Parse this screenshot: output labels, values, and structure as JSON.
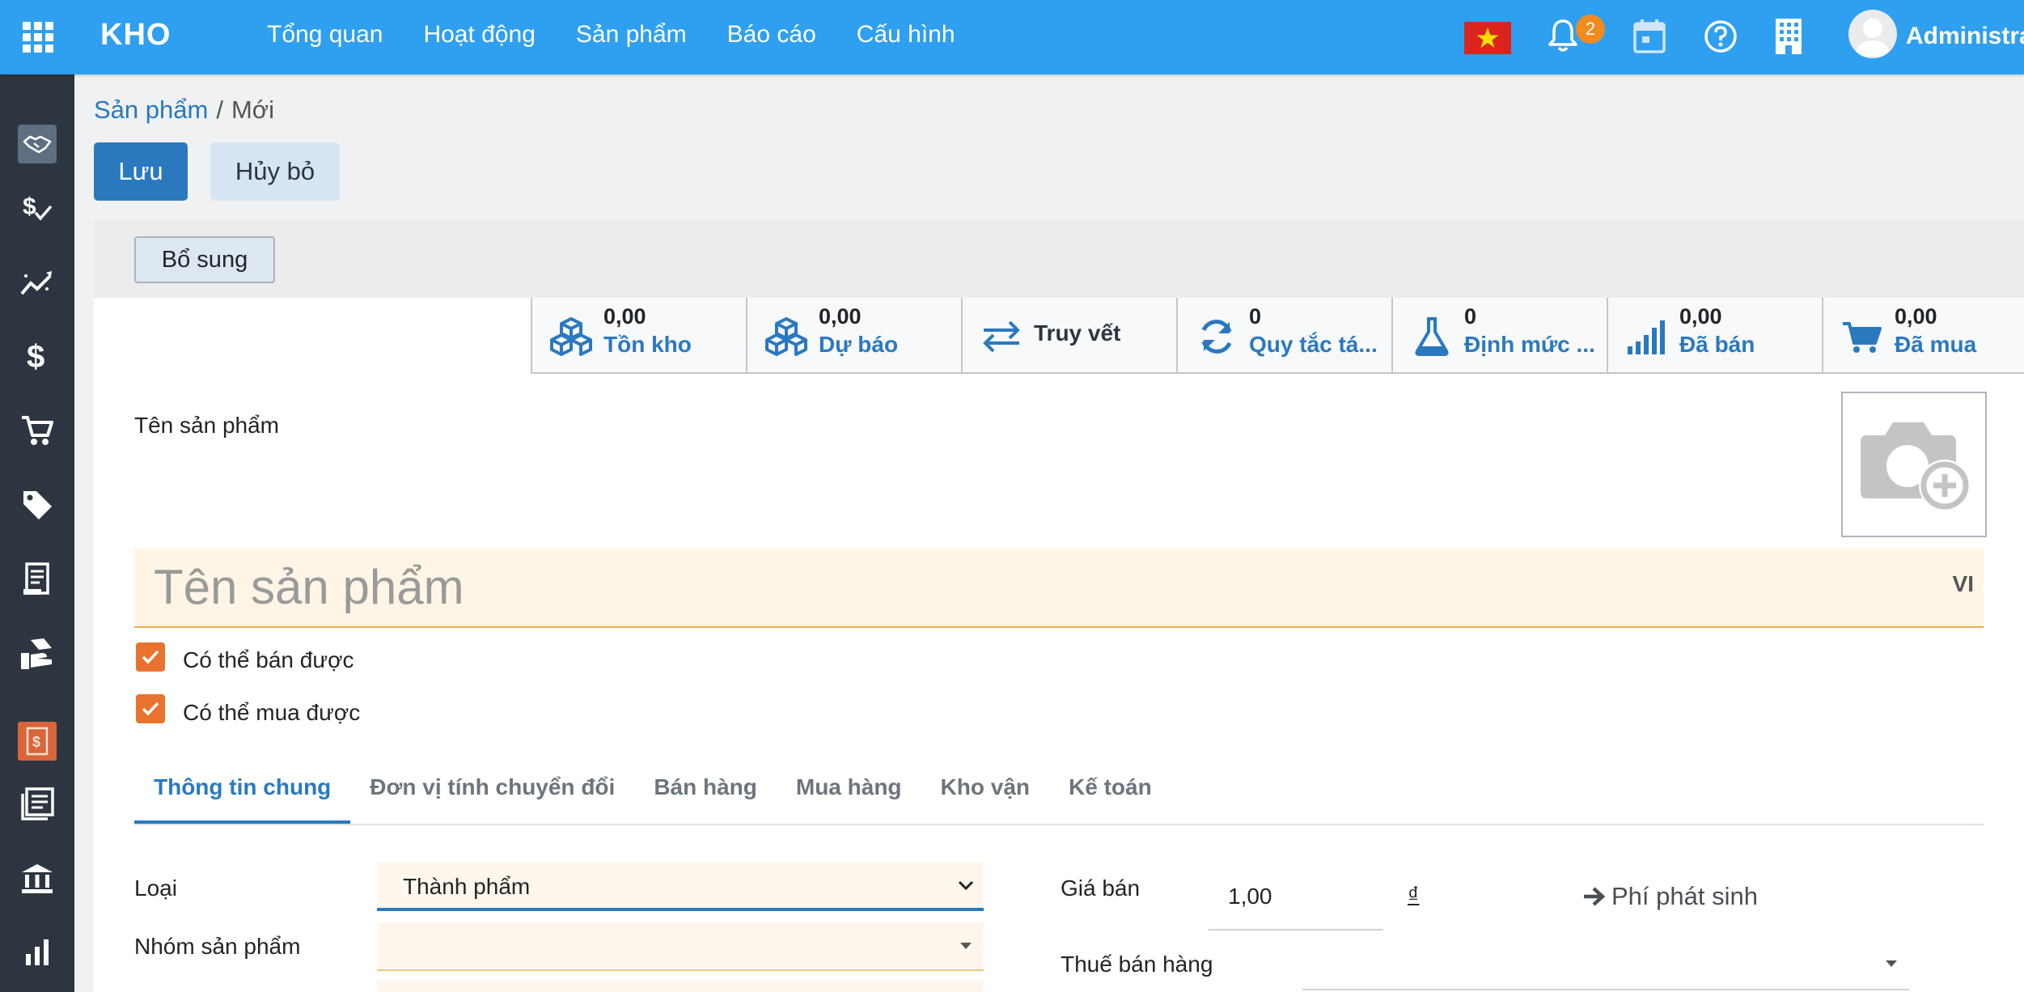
{
  "app": {
    "brand": "KHO",
    "menu": [
      "Tổng quan",
      "Hoạt động",
      "Sản phẩm",
      "Báo cáo",
      "Cấu hình"
    ],
    "notification_count": "2",
    "user_name": "Administrat"
  },
  "rail_icons": [
    "handshake-icon",
    "dollar-check-icon",
    "trend-icon",
    "dollar-icon",
    "cart-icon",
    "tag-icon",
    "receipt-icon",
    "hand-money-icon",
    "invoice-icon",
    "books-icon",
    "bank-icon",
    "chart-icon"
  ],
  "breadcrumb": {
    "parent": "Sản phẩm",
    "separator": "/",
    "current": "Mới"
  },
  "actions": {
    "save": "Lưu",
    "discard": "Hủy bỏ",
    "extra": "Bổ sung"
  },
  "stat_buttons": [
    {
      "icon": "cubes-icon",
      "value": "0,00",
      "label": "Tồn kho"
    },
    {
      "icon": "cubes-icon",
      "value": "0,00",
      "label": "Dự báo"
    },
    {
      "icon": "arrows-exchange-icon",
      "value": "",
      "label": "Truy vết"
    },
    {
      "icon": "refresh-icon",
      "value": "0",
      "label": "Quy tắc tá..."
    },
    {
      "icon": "flask-icon",
      "value": "0",
      "label": "Định mức ..."
    },
    {
      "icon": "signal-icon",
      "value": "0,00",
      "label": "Đã bán"
    },
    {
      "icon": "shopping-cart-icon",
      "value": "0,00",
      "label": "Đã mua"
    }
  ],
  "form": {
    "name_label": "Tên sản phẩm",
    "name_placeholder": "Tên sản phẩm",
    "lang": "VI",
    "can_be_sold": {
      "label": "Có thể bán được",
      "checked": true
    },
    "can_be_purchased": {
      "label": "Có thể mua được",
      "checked": true
    },
    "tabs": [
      "Thông tin chung",
      "Đơn vị tính chuyển đổi",
      "Bán hàng",
      "Mua hàng",
      "Kho vận",
      "Kế toán"
    ],
    "type_label": "Loại",
    "type_value": "Thành phẩm",
    "category_label": "Nhóm sản phẩm",
    "category_value": "",
    "price_label": "Giá bán",
    "price_value": "1,00",
    "currency": "₫",
    "extra_fee_label": "Phí phát sinh",
    "sales_tax_label": "Thuế bán hàng",
    "sales_tax_value": ""
  },
  "colors": {
    "navbar": "#2f9ff0",
    "rail": "#2d3640",
    "primary": "#2a79bf",
    "checkbox": "#e9732e",
    "badge": "#f28b1e"
  }
}
